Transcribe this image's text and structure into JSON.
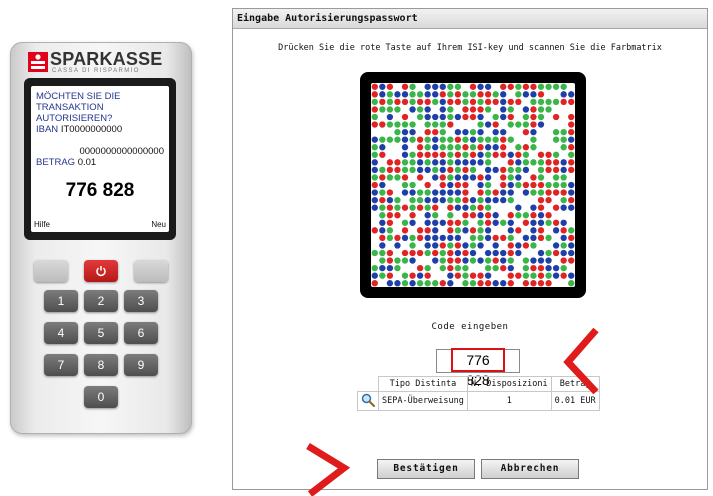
{
  "token": {
    "brand_name": "SPARKASSE",
    "brand_sub": "CASSA DI RISPARMIO",
    "display": {
      "question": "MÖCHTEN SIE DIE TRANSAKTION AUTORISIEREN?",
      "iban_label": "IBAN",
      "iban_value_1": "IT0000000000",
      "iban_value_2": "0000000000000000",
      "betrag_label": "BETRAG",
      "betrag_value": "0.01",
      "code": "776 828",
      "soft_left": "Hilfe",
      "soft_right": "Neu"
    },
    "keys": [
      "1",
      "2",
      "3",
      "4",
      "5",
      "6",
      "7",
      "8",
      "9",
      "0"
    ],
    "colors": {
      "power_key": "#d42323",
      "display_text": "#23368f"
    }
  },
  "dialog": {
    "title": "Eingabe Autorisierungspasswort",
    "instruction": "Drücken Sie die rote Taste auf Ihrem ISI-key und scannen Sie die Farbmatrix",
    "code_label": "Code eingeben",
    "code_value": "776 828",
    "table": {
      "headers": [
        "Tipo Distinta",
        "N. Disposizioni",
        "Betrag"
      ],
      "rows": [
        {
          "tipo": "SEPA-Überweisung",
          "n": "1",
          "betrag": "0.01 EUR"
        }
      ]
    },
    "confirm_label": "Bestätigen",
    "cancel_label": "Abbrechen",
    "matrix_colors": [
      "#e02424",
      "#3ab54a",
      "#1f3fa8"
    ]
  },
  "annotation": {
    "arrow_color": "#e01b1b"
  }
}
